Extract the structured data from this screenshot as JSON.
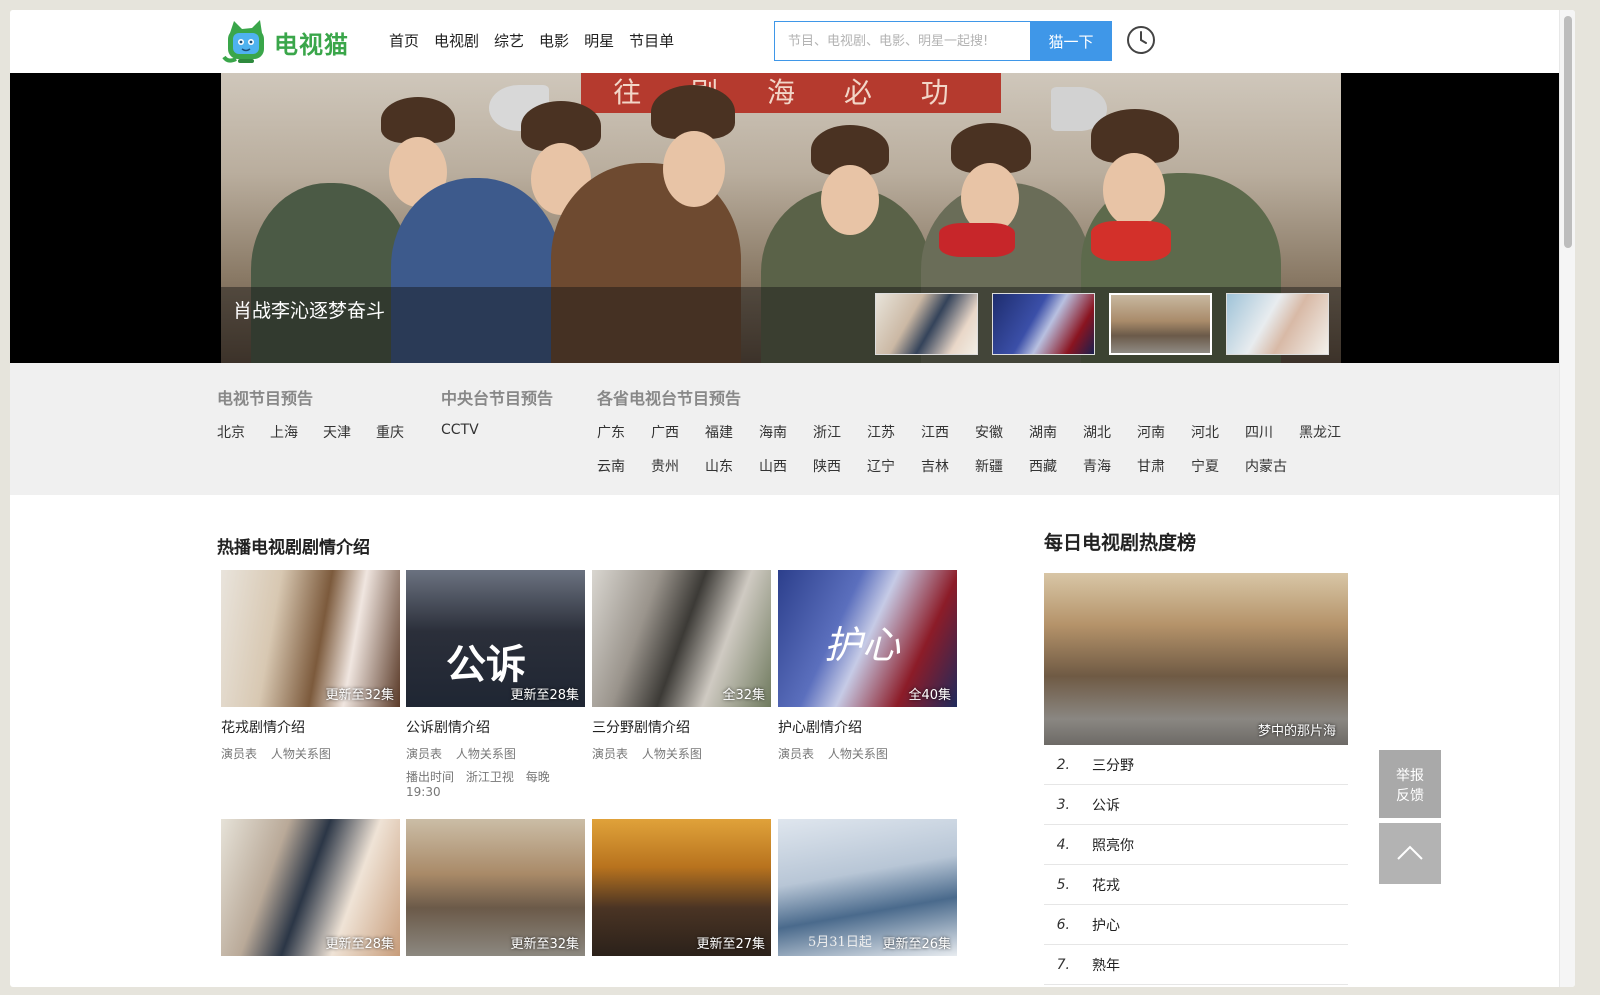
{
  "header": {
    "logo_text": "电视猫",
    "nav": [
      "首页",
      "电视剧",
      "综艺",
      "电影",
      "明星",
      "节目单"
    ],
    "search_placeholder": "节目、电视剧、电影、明星一起搜!",
    "search_button": "猫一下"
  },
  "banner": {
    "sign_text": "往 剧 海 必 功",
    "caption": "肖战李沁逐梦奋斗",
    "thumb_count": 4
  },
  "preview": {
    "tv": {
      "title": "电视节目预告",
      "items": [
        "北京",
        "上海",
        "天津",
        "重庆"
      ]
    },
    "cctv": {
      "title": "中央台节目预告",
      "items": [
        "CCTV"
      ]
    },
    "prov": {
      "title": "各省电视台节目预告",
      "row1": [
        "广东",
        "广西",
        "福建",
        "海南",
        "浙江",
        "江苏",
        "江西",
        "安徽",
        "湖南",
        "湖北",
        "河南",
        "河北",
        "四川",
        "黑龙江"
      ],
      "row2": [
        "云南",
        "贵州",
        "山东",
        "山西",
        "陕西",
        "辽宁",
        "吉林",
        "新疆",
        "西藏",
        "青海",
        "甘肃",
        "宁夏",
        "内蒙古"
      ]
    }
  },
  "hot": {
    "title": "热播电视剧剧情介绍",
    "cards": [
      {
        "badge": "更新至32集",
        "title": "花戎剧情介绍",
        "link1": "演员表",
        "link2": "人物关系图"
      },
      {
        "badge": "更新至28集",
        "title": "公诉剧情介绍",
        "link1": "演员表",
        "link2": "人物关系图",
        "extra_label": "播出时间",
        "extra_channel": "浙江卫视",
        "extra_time": "每晚19:30",
        "poster_text": "公诉"
      },
      {
        "badge": "全32集",
        "title": "三分野剧情介绍",
        "link1": "演员表",
        "link2": "人物关系图"
      },
      {
        "badge": "全40集",
        "title": "护心剧情介绍",
        "link1": "演员表",
        "link2": "人物关系图",
        "poster_text": "护心"
      },
      {
        "badge": "更新至28集"
      },
      {
        "badge": "更新至32集"
      },
      {
        "badge": "更新至27集"
      },
      {
        "badge": "更新至26集",
        "poster_text": "5月31日起"
      }
    ]
  },
  "ranking": {
    "title": "每日电视剧热度榜",
    "top_label": "梦中的那片海",
    "items": [
      {
        "num": "2.",
        "name": "三分野"
      },
      {
        "num": "3.",
        "name": "公诉"
      },
      {
        "num": "4.",
        "name": "照亮你"
      },
      {
        "num": "5.",
        "name": "花戎"
      },
      {
        "num": "6.",
        "name": "护心"
      },
      {
        "num": "7.",
        "name": "熟年"
      }
    ]
  },
  "float": {
    "report": "举报\n反馈"
  },
  "colors": {
    "accent": "#3f97e8",
    "logo_green": "#3aa64a"
  }
}
